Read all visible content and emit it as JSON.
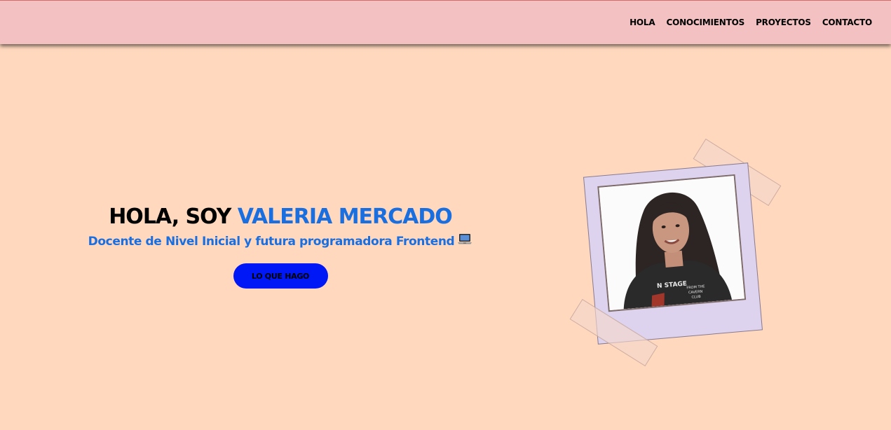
{
  "nav": {
    "items": [
      {
        "label": "HOLA"
      },
      {
        "label": "CONOCIMIENTOS"
      },
      {
        "label": "PROYECTOS"
      },
      {
        "label": "CONTACTO"
      }
    ]
  },
  "hero": {
    "greeting": "HOLA, SOY",
    "name": "VALERIA MERCADO",
    "subtitle": "Docente de Nivel Inicial y futura programadora Frontend",
    "subtitle_icon": "laptop-icon",
    "cta_label": "LO QUE HAGO"
  },
  "photo": {
    "shirt_text_line1": "N STAGE",
    "shirt_text_line2": "FROM THE",
    "shirt_text_line3": "CAVERN",
    "shirt_text_line4": "CLUB"
  },
  "colors": {
    "background": "#ffd8be",
    "navbar": "#f3c1c1",
    "accent_blue": "#1a6fe0",
    "button": "#0018f5",
    "polaroid": "#ded3ee"
  }
}
